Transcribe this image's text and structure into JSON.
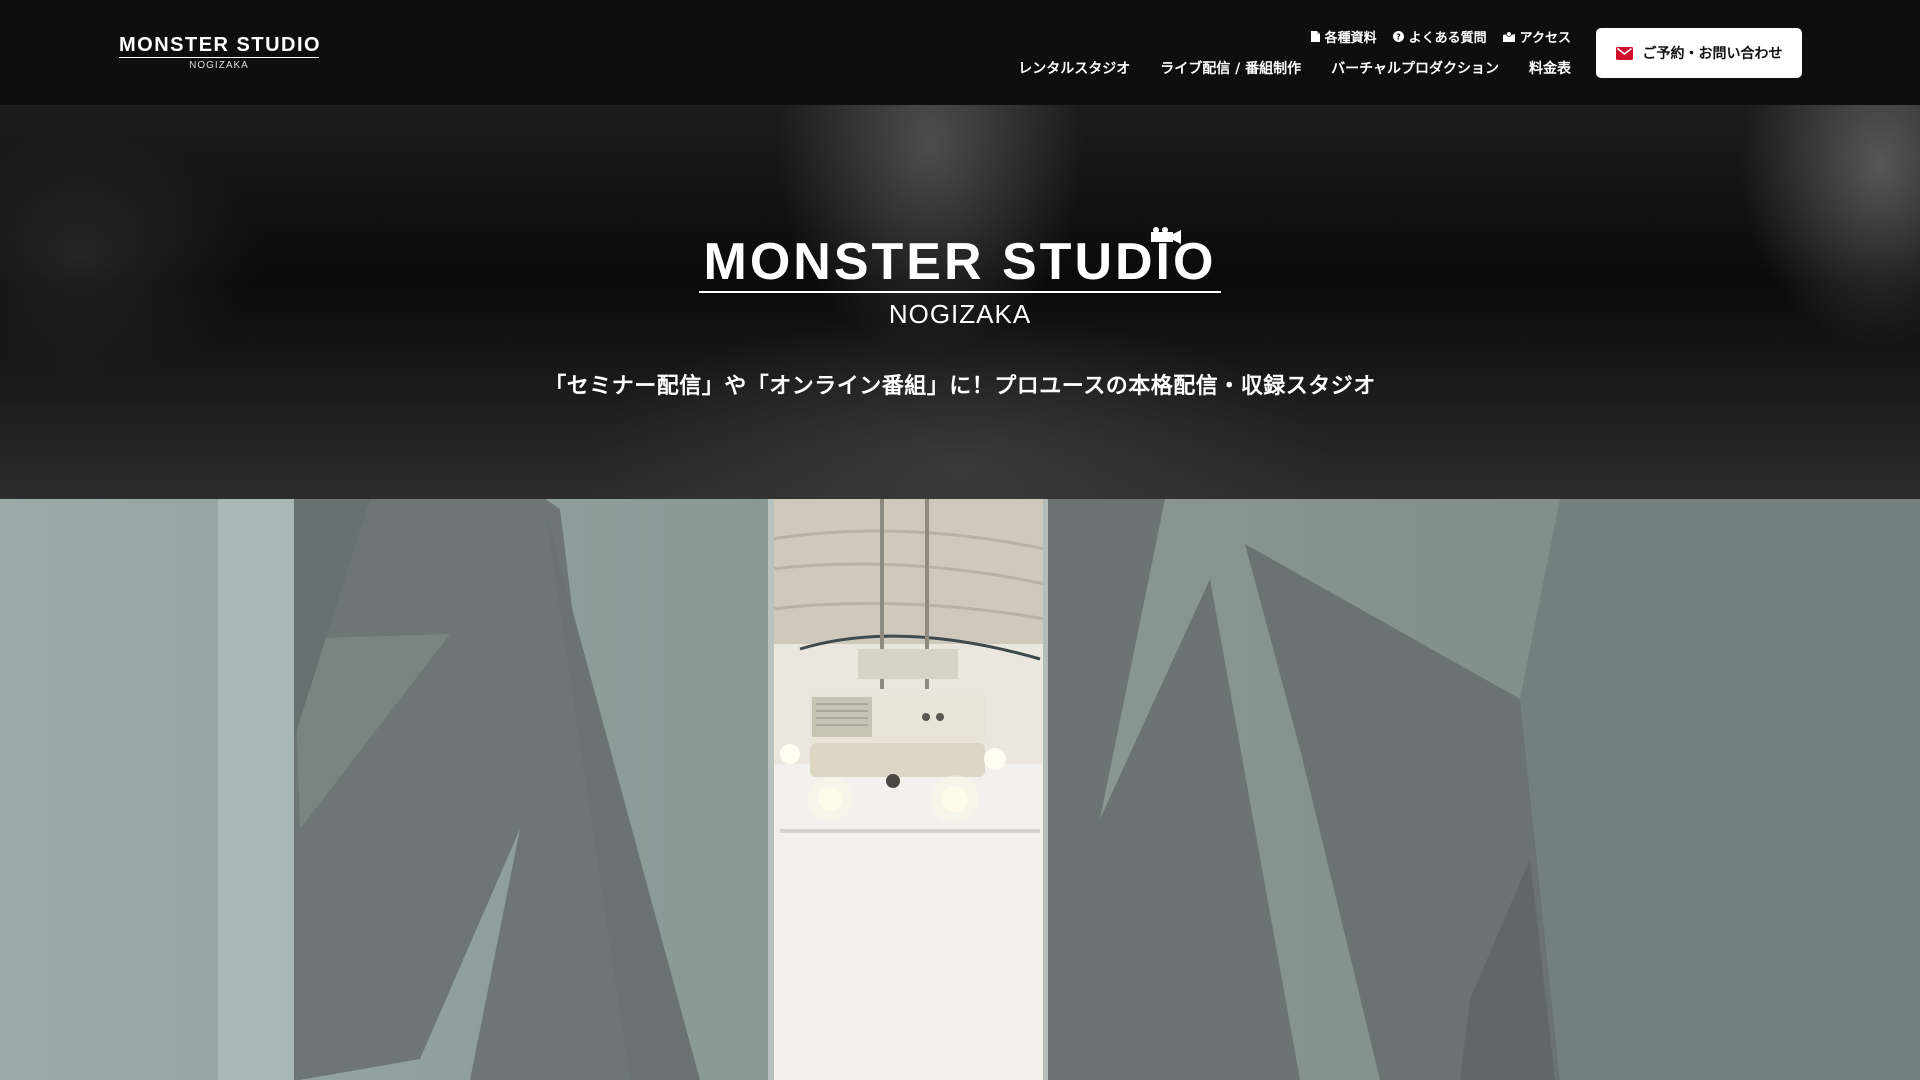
{
  "header": {
    "logo": {
      "main": "MONSTER STUDIO",
      "sub": "NOGIZAKA"
    },
    "util_links": [
      {
        "label": "各種資料",
        "icon": "document-icon"
      },
      {
        "label": "よくある質問",
        "icon": "question-circle-icon"
      },
      {
        "label": "アクセス",
        "icon": "map-icon"
      }
    ],
    "nav": [
      {
        "label": "レンタルスタジオ"
      },
      {
        "label": "ライブ配信 / 番組制作"
      },
      {
        "label": "バーチャルプロダクション"
      },
      {
        "label": "料金表"
      }
    ],
    "cta": {
      "label": "ご予約・お問い合わせ",
      "icon": "mail-icon",
      "icon_color": "#d0102b"
    }
  },
  "hero": {
    "logo": {
      "main": "MONSTER STUDIO",
      "sub": "NOGIZAKA"
    },
    "tagline": "「セミナー配信」や「オンライン番組」に！プロユースの本格配信・収録スタジオ"
  },
  "video": {
    "description_icon": "studio-camera-icon"
  }
}
